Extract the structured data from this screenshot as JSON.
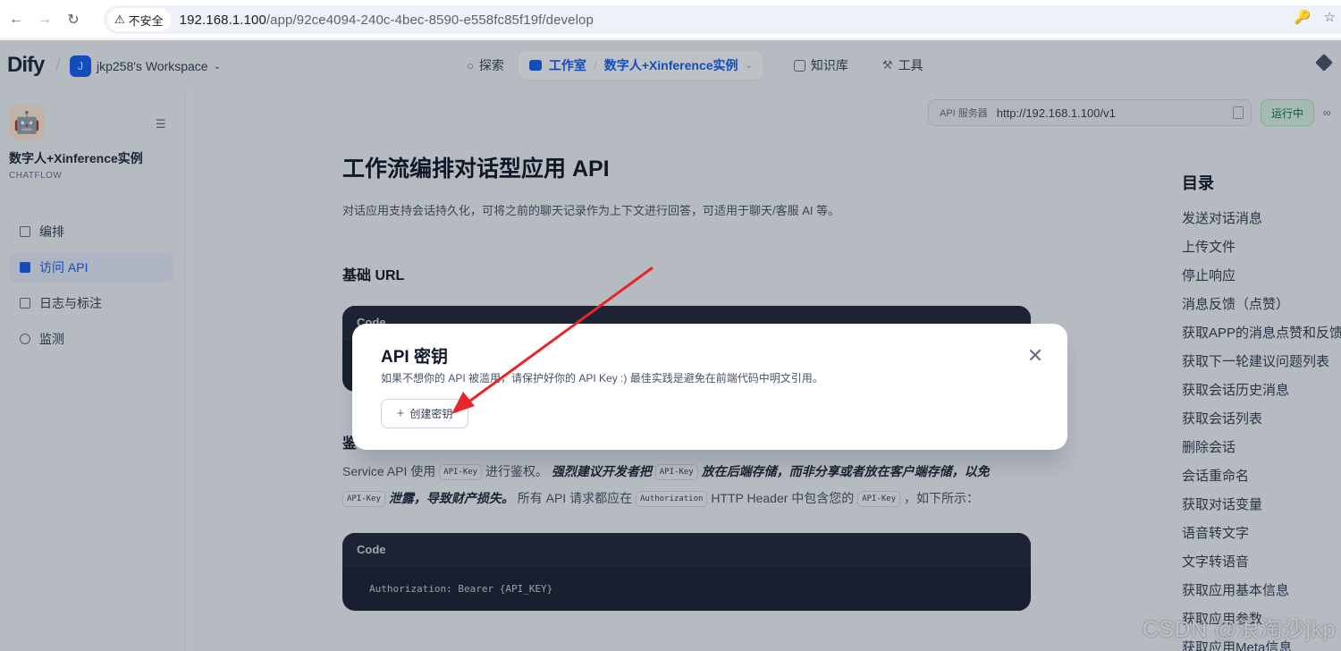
{
  "browser": {
    "back_icon": "arrow-left-icon",
    "forward_icon": "arrow-right-icon",
    "reload_icon": "reload-icon",
    "security_label": "不安全",
    "url_host": "192.168.1.100",
    "url_path": "/app/92ce4094-240c-4bec-8590-e558fc85f19f/develop"
  },
  "header": {
    "logo": "Dify",
    "workspace_initial": "J",
    "workspace_name": "jkp258's Workspace",
    "nav": {
      "explore": "探索",
      "studio": "工作室",
      "current_app": "数字人+Xinference实例",
      "knowledge": "知识库",
      "tools": "工具"
    }
  },
  "sidebar": {
    "app_name": "数字人+Xinference实例",
    "app_type": "CHATFLOW",
    "items": [
      {
        "label": "编排"
      },
      {
        "label": "访问 API"
      },
      {
        "label": "日志与标注"
      },
      {
        "label": "监测"
      }
    ]
  },
  "toolbar": {
    "api_server_label": "API 服务器",
    "api_server_url": "http://192.168.1.100/v1",
    "status": "运行中"
  },
  "doc": {
    "title": "工作流编排对话型应用 API",
    "description": "对话应用支持会话持久化，可将之前的聊天记录作为上下文进行回答，可适用于聊天/客服 AI 等。",
    "base_url_heading": "基础 URL",
    "code_label": "Code",
    "auth_heading_fragment": "鉴",
    "auth_para": {
      "p1": "Service API 使用",
      "k1": "API-Key",
      "p2": "进行鉴权。",
      "b1": "强烈建议开发者把",
      "k2": "API-Key",
      "b2": "放在后端存储，而非分享或者放在客户端存储，以免",
      "k3": "API-Key",
      "b3": "泄露，导致财产损失。",
      "p3": "所有 API 请求都应在",
      "k4": "Authorization",
      "p4": "HTTP Header 中包含您的",
      "k5": "API-Key",
      "p5": "，如下所示："
    },
    "auth_code": "Authorization: Bearer {API_KEY}"
  },
  "toc": {
    "title": "目录",
    "items": [
      "发送对话消息",
      "上传文件",
      "停止响应",
      "消息反馈（点赞）",
      "获取APP的消息点赞和反馈",
      "获取下一轮建议问题列表",
      "获取会话历史消息",
      "获取会话列表",
      "删除会话",
      "会话重命名",
      "获取对话变量",
      "语音转文字",
      "文字转语音",
      "获取应用基本信息",
      "获取应用参数",
      "获取应用Meta信息"
    ]
  },
  "modal": {
    "title": "API 密钥",
    "description": "如果不想你的 API 被滥用，请保护好你的 API Key :) 最佳实践是避免在前端代码中明文引用。",
    "create_button": "创建密钥",
    "close_icon": "close-icon"
  },
  "annotation": {
    "arrow_color": "#e5262a"
  },
  "watermark": "CSDN @浪淘沙jkp"
}
